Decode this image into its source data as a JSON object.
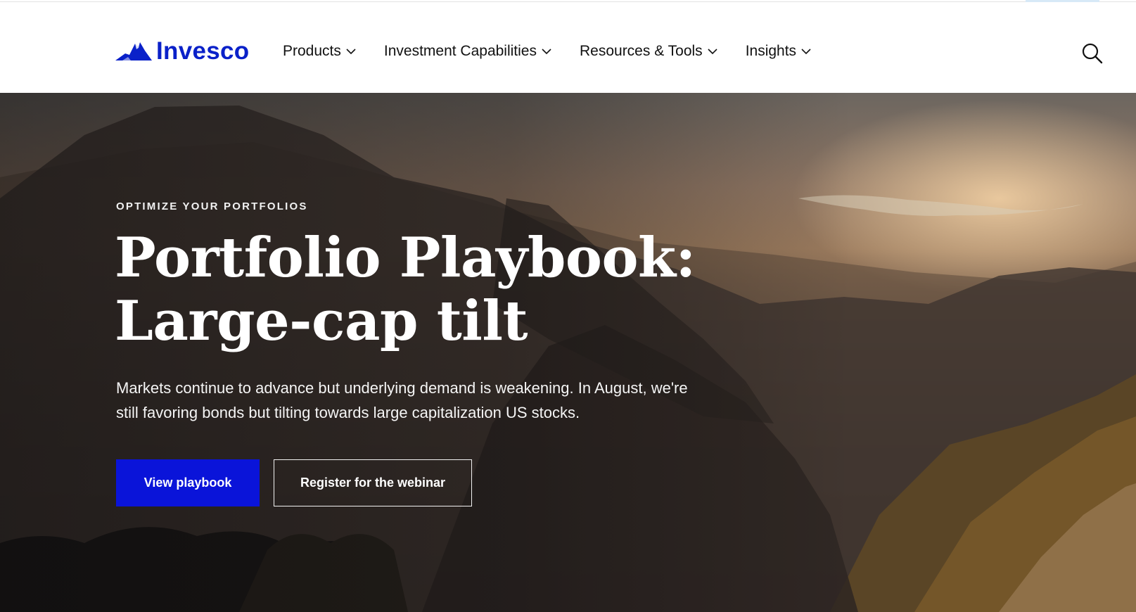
{
  "brand": {
    "name": "Invesco",
    "color": "#0a21c9",
    "logo_icon": "mountain-logo-icon"
  },
  "nav": {
    "items": [
      {
        "label": "Products",
        "icon": "chevron-down-icon"
      },
      {
        "label": "Investment Capabilities",
        "icon": "chevron-down-icon"
      },
      {
        "label": "Resources & Tools",
        "icon": "chevron-down-icon"
      },
      {
        "label": "Insights",
        "icon": "chevron-down-icon"
      }
    ],
    "search_icon": "search-icon"
  },
  "hero": {
    "eyebrow": "OPTIMIZE YOUR PORTFOLIOS",
    "headline_line1": "Portfolio Playbook:",
    "headline_line2": "Large-cap tilt",
    "subtext": "Markets continue to advance but underlying demand is weakening. In August, we're still favoring bonds but tilting towards large capitalization US stocks.",
    "primary_button": "View playbook",
    "secondary_button": "Register for the webinar",
    "primary_color": "#0a14d9"
  }
}
